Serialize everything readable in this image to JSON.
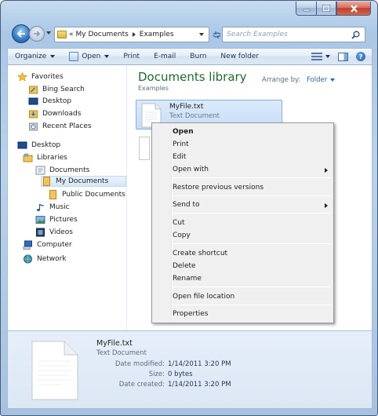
{
  "window": {
    "caption_buttons": {
      "min": "minimize-icon",
      "max": "maximize-icon",
      "close": "close-icon"
    }
  },
  "address_bar": {
    "overflow": "«",
    "crumbs": [
      "My Documents",
      "Examples"
    ],
    "search_placeholder": "Search Examples"
  },
  "commands": {
    "organize": "Organize",
    "open": "Open",
    "print": "Print",
    "email": "E-mail",
    "burn": "Burn",
    "new_folder": "New folder"
  },
  "nav": {
    "favorites": "Favorites",
    "bing": "Bing Search",
    "desktop_fav": "Desktop",
    "downloads": "Downloads",
    "recent": "Recent Places",
    "desktop": "Desktop",
    "libraries": "Libraries",
    "documents": "Documents",
    "my_documents": "My Documents",
    "public_documents": "Public Documents",
    "music": "Music",
    "pictures": "Pictures",
    "videos": "Videos",
    "computer": "Computer",
    "network": "Network"
  },
  "library": {
    "title": "Documents library",
    "subtitle": "Examples",
    "arrange_label": "Arrange by:",
    "arrange_value": "Folder"
  },
  "file": {
    "name": "MyFile.txt",
    "type": "Text Document"
  },
  "context_menu": {
    "open": "Open",
    "print": "Print",
    "edit": "Edit",
    "open_with": "Open with",
    "restore": "Restore previous versions",
    "send_to": "Send to",
    "cut": "Cut",
    "copy": "Copy",
    "create_shortcut": "Create shortcut",
    "delete": "Delete",
    "rename": "Rename",
    "open_location": "Open file location",
    "properties": "Properties"
  },
  "details": {
    "name": "MyFile.txt",
    "type": "Text Document",
    "modified_label": "Date modified:",
    "modified_value": "1/14/2011 3:20 PM",
    "size_label": "Size:",
    "size_value": "0 bytes",
    "created_label": "Date created:",
    "created_value": "1/14/2011 3:20 PM"
  }
}
